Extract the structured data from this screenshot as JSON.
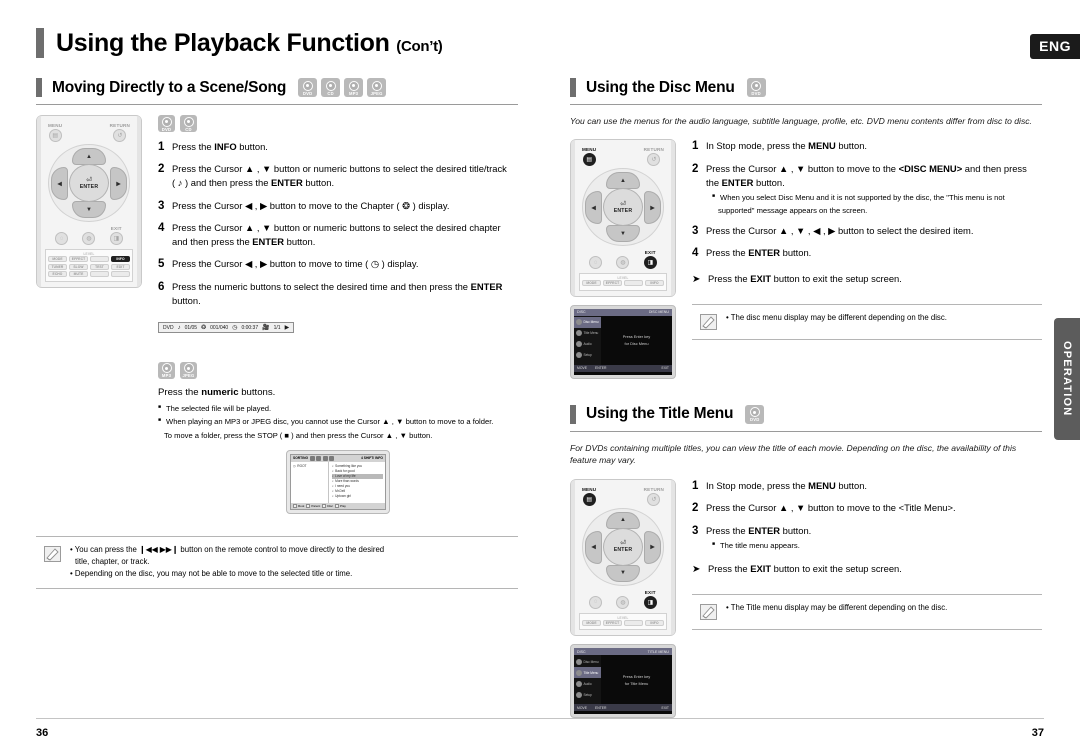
{
  "header": {
    "title": "Using the Playback Function",
    "title_suffix": "(Con’t)",
    "lang_tab": "ENG",
    "side_tab": "OPERATION"
  },
  "footer": {
    "page_left": "36",
    "page_right": "37"
  },
  "icons": {
    "dvd": "DVD",
    "cd": "CD",
    "mp3": "MP3",
    "jpeg": "JPEG",
    "menu": "MENU",
    "return": "RETURN",
    "exit": "EXIT",
    "enter": "ENTER",
    "up": "▲",
    "down": "▼",
    "left": "◀",
    "right": "▶"
  },
  "sections": {
    "moving": {
      "heading": "Moving Directly to a Scene/Song",
      "discs": [
        "DVD",
        "CD",
        "MP3",
        "JPEG"
      ],
      "group1_discs": [
        "DVD",
        "CD"
      ],
      "steps": [
        {
          "num": "1",
          "html": "Press the <b>INFO</b> button."
        },
        {
          "num": "2",
          "html": "Press the Cursor ▲ , ▼ button or numeric buttons to select the desired title/track (&nbsp;♪&nbsp;) and then press the <b>ENTER</b> button."
        },
        {
          "num": "3",
          "html": "Press the Cursor ◀ , ▶ button to move to the Chapter ( ❂ ) display."
        },
        {
          "num": "4",
          "html": "Press the Cursor ▲ , ▼ button or numeric buttons to select the desired chapter and then press the <b>ENTER</b> button."
        },
        {
          "num": "5",
          "html": "Press the Cursor ◀ , ▶ button to move to time ( ◷ ) display."
        },
        {
          "num": "6",
          "html": "Press the numeric buttons to select the desired time and then press the <b>ENTER</b> button."
        }
      ],
      "osd": {
        "disc_type": "DVD",
        "title": "01/05",
        "chapter": "001/040",
        "time": "0:00:37",
        "audio": "1/1"
      },
      "group2_discs": [
        "MP3",
        "JPEG"
      ],
      "group2_lead_html": "Press the <b>numeric</b> buttons.",
      "group2_notes": [
        "The selected file will be played.",
        "When playing an MP3 or JPEG disc, you cannot use the Cursor ▲ , ▼ button to move to a folder.",
        "To move a folder, press the STOP ( ■ ) and then press the Cursor ▲ , ▼ button."
      ],
      "note_lines": [
        "• You can press the ❙◀◀ ▶▶❙ button on the remote control to move directly to the desired",
        "title, chapter, or track.",
        "• Depending on the disc, you may not be able to move to the selected title or time."
      ]
    },
    "disc_menu": {
      "heading": "Using the Disc Menu",
      "discs": [
        "DVD"
      ],
      "intro": "You can use the menus for the audio language, subtitle language, profile, etc. DVD menu contents differ from disc to disc.",
      "steps": [
        {
          "num": "1",
          "html": "In Stop mode, press the <b>MENU</b> button."
        },
        {
          "num": "2",
          "html": "Press the Cursor ▲ , ▼ button to move to the <b>&lt;DISC MENU&gt;</b> and then press the <b>ENTER</b> button."
        },
        {
          "num": "3",
          "html": "Press the Cursor ▲ , ▼ , ◀ , ▶ button to select the desired item."
        },
        {
          "num": "4",
          "html": "Press the <b>ENTER</b> button."
        }
      ],
      "step2_notes": [
        "When you select Disc Menu and it is not supported by the disc, the \"This menu is not",
        "supported\" message appears on the screen."
      ],
      "exit_html": "Press the <b>EXIT</b> button to exit the setup screen.",
      "note_lines": [
        "• The disc menu display may be different depending on the disc."
      ],
      "tv": {
        "top_left": "DISC",
        "top_right": "DISC MENU",
        "items": [
          "Disc Menu",
          "Title Menu",
          "Audio",
          "Setup"
        ],
        "selected": "Disc Menu",
        "center_line1": "Press Enter key",
        "center_line2": "for Disc Menu",
        "bottom": [
          "MOVE",
          "ENTER",
          "EXIT"
        ]
      }
    },
    "title_menu": {
      "heading": "Using the Title Menu",
      "discs": [
        "DVD"
      ],
      "intro": "For DVDs containing multiple titles, you can view the title of each movie. Depending on the disc, the availability of this feature may vary.",
      "steps": [
        {
          "num": "1",
          "html": "In Stop mode, press the <b>MENU</b> button."
        },
        {
          "num": "2",
          "html": "Press the Cursor ▲ , ▼ button to move to the &lt;Title Menu&gt;."
        },
        {
          "num": "3",
          "html": "Press the <b>ENTER</b> button."
        }
      ],
      "step3_notes": [
        "The title menu appears."
      ],
      "exit_html": "Press the <b>EXIT</b> button to exit the setup screen.",
      "note_lines": [
        "• The Title menu display may be different depending on the disc."
      ],
      "tv": {
        "top_left": "DISC",
        "top_right": "TITLE MENU",
        "items": [
          "Disc Menu",
          "Title Menu",
          "Audio",
          "Setup"
        ],
        "selected": "Title Menu",
        "center_line1": "Press Enter key",
        "center_line2": "for Title Menu",
        "bottom": [
          "MOVE",
          "ENTER",
          "EXIT"
        ]
      }
    }
  },
  "remote_left": {
    "labels": {
      "menu": "MENU",
      "return": "RETURN",
      "exit": "EXIT",
      "enter": "ENTER"
    },
    "highlighted": "INFO",
    "keypad": {
      "caption_left": "LEVEL",
      "caption_right": "DSP/EQ",
      "rows": [
        [
          "MODE",
          "EFFECT",
          "",
          "INFO"
        ],
        [
          "TUNER MEMORY",
          "SLOW",
          "TEST TONE",
          "SOUND EDIT"
        ],
        [
          "ECHO",
          "MUTE",
          "",
          ""
        ]
      ]
    }
  },
  "remote_right": {
    "labels": {
      "menu": "MENU",
      "return": "RETURN",
      "exit": "EXIT",
      "enter": "ENTER"
    },
    "highlighted": "MENU, EXIT",
    "keypad": {
      "caption_left": "LEVEL",
      "caption_right": "DSP/EQ",
      "rows": [
        [
          "MODE",
          "EFFECT",
          "",
          "INFO"
        ]
      ]
    }
  },
  "mp3_screen": {
    "title": "SORTING",
    "counter": "4 SHIFT/ INFO",
    "folder": "ROOT",
    "tracks": [
      "Something like you",
      "Back for good",
      "Love of my life",
      "More than words",
      "I need you",
      "Mr.Dell",
      "Uptown girl"
    ],
    "selected_index": 2,
    "buttons": [
      "Root",
      "Parent",
      "Disc",
      "Play"
    ]
  }
}
